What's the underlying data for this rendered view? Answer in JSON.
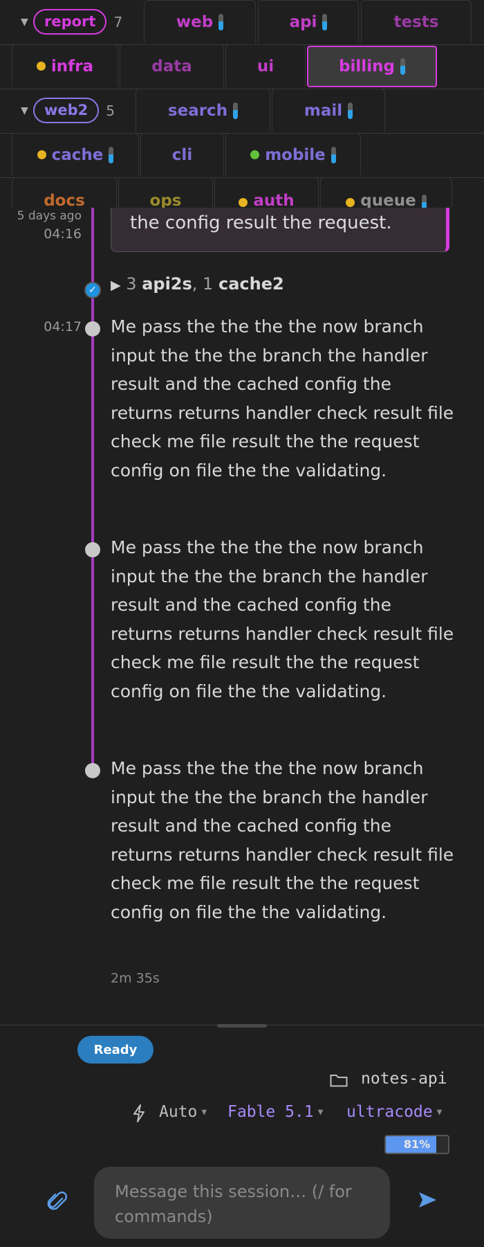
{
  "colors": {
    "accent_magenta": "#d73ce0",
    "accent_violet": "#9b7cf0",
    "status_blue": "#2fa3e8",
    "ready_blue": "#2b7ebf"
  },
  "tab_groups": [
    {
      "name": "report",
      "count": "7",
      "color": "#d73ce0",
      "rows": [
        [
          {
            "label": "web",
            "indicator": true
          },
          {
            "label": "api",
            "indicator": true
          },
          {
            "label": "tests"
          }
        ],
        [
          {
            "label": "infra",
            "dot": "#e8b320"
          },
          {
            "label": "data"
          },
          {
            "label": "ui"
          },
          {
            "label": "billing",
            "indicator": true,
            "active": true
          }
        ]
      ]
    },
    {
      "name": "web2",
      "count": "5",
      "color": "#8b78e6",
      "rows": [
        [
          {
            "label": "search",
            "indicator": true
          },
          {
            "label": "mail",
            "indicator": true
          }
        ],
        [
          {
            "label": "cache",
            "dot": "#e8b320",
            "indicator": true
          },
          {
            "label": "cli"
          },
          {
            "label": "mobile",
            "dot": "#63c23c",
            "indicator": true
          }
        ]
      ]
    },
    {
      "name": "",
      "rows": [
        [
          {
            "label": "docs"
          },
          {
            "label": "ops"
          },
          {
            "label": "auth",
            "dot": "#e8b320"
          },
          {
            "label": "queue",
            "dot": "#e8b320",
            "indicator": true
          }
        ]
      ]
    }
  ],
  "timeline": {
    "prev_message_tail": "the config result the request.",
    "prev_relative": "5 days ago",
    "prev_time": "04:16",
    "tool_summary": {
      "count1": "3",
      "name1": "api2s",
      "count2": "1",
      "name2": "cache2"
    },
    "message_time": "04:17",
    "messages": [
      "Me pass the the the the now branch input the the the branch the handler result and the cached config the returns returns handler check result file check me file result the the request config on file the the validating.",
      "Me pass the the the the now branch input the the the branch the handler result and the cached config the returns returns handler check result file check me file result the the request config on file the the validating.",
      "Me pass the the the the now branch input the the the branch the handler result and the cached config the returns returns handler check result file check me file result the the request config on file the the validating."
    ],
    "duration": "2m 35s"
  },
  "status": {
    "badge": "Ready"
  },
  "project": {
    "name": "notes-api",
    "icon": "folder-icon"
  },
  "controls": {
    "mode": "Auto",
    "model": "Fable 5.1",
    "profile": "ultracode"
  },
  "context": {
    "percent_label": "81%",
    "fraction": 0.81
  },
  "composer": {
    "placeholder": "Message this session…  (/ for commands)"
  }
}
